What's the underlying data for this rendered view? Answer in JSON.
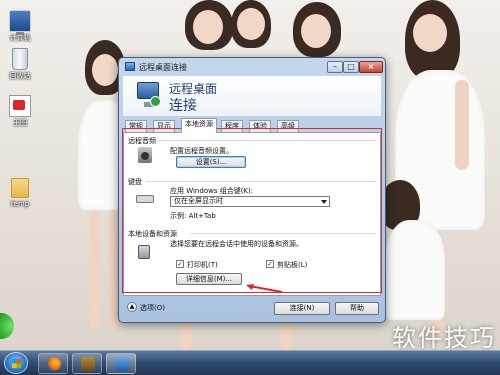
{
  "desktop": {
    "icons": [
      {
        "label": "计算机",
        "icon": "computer-icon"
      },
      {
        "label": "回收站",
        "icon": "recycle-bin-icon"
      },
      {
        "label": "王图",
        "icon": "document-icon"
      },
      {
        "label": "temp",
        "icon": "folder-icon"
      }
    ]
  },
  "window": {
    "title": "远程桌面连接",
    "banner_line1": "远程桌面",
    "banner_line2": "连接",
    "tabs": [
      "常规",
      "显示",
      "本地资源",
      "程序",
      "体验",
      "高级"
    ],
    "active_tab": "本地资源",
    "audio": {
      "heading": "远程音频",
      "description": "配置远程音频设置。",
      "settings_button": "设置(S)..."
    },
    "keyboard": {
      "heading": "键盘",
      "label": "应用 Windows 组合键(K):",
      "selected": "仅在全屏显示时",
      "example": "示例: Alt+Tab"
    },
    "local_devices": {
      "heading": "本地设备和资源",
      "description": "选择您要在远程会话中使用的设备和资源。",
      "printers_label": "打印机(T)",
      "printers_checked": true,
      "clipboard_label": "剪贴板(L)",
      "clipboard_checked": true,
      "more_button": "详细信息(M)..."
    },
    "footer": {
      "options_label": "选项(O)",
      "connect_button": "连接(N)",
      "help_button": "帮助"
    }
  },
  "colors": {
    "annotation": "#e0262b",
    "banner_text": "#1e3f7a"
  },
  "watermark": "软件技巧"
}
